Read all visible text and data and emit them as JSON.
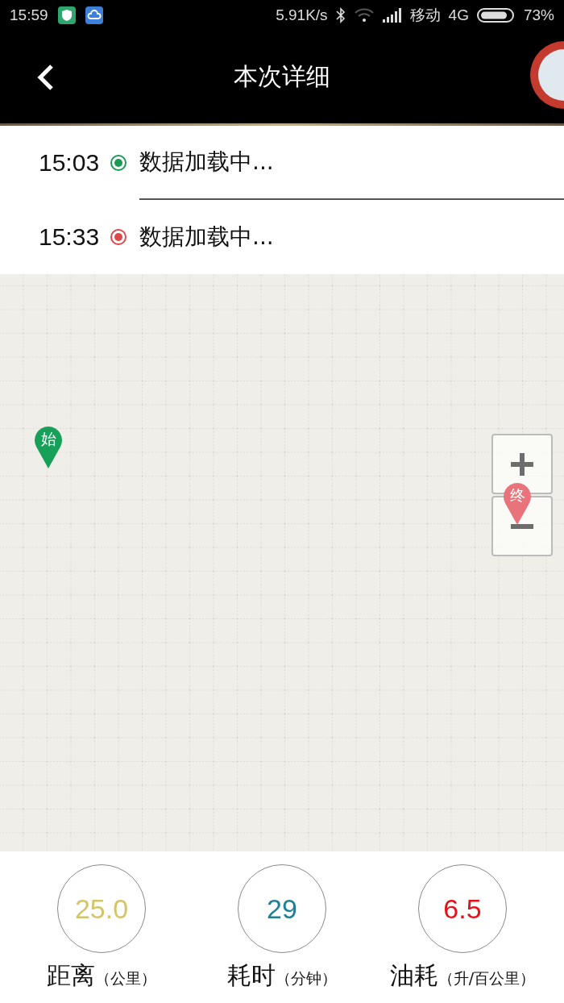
{
  "status_bar": {
    "time": "15:59",
    "speed": "5.91K/s",
    "carrier": "移动",
    "network": "4G",
    "battery": "73%"
  },
  "header": {
    "title": "本次详细"
  },
  "trip_points": [
    {
      "time": "15:03",
      "color": "#1a9a55",
      "text": "数据加载中..."
    },
    {
      "time": "15:33",
      "color": "#e0474c",
      "text": "数据加载中..."
    }
  ],
  "map": {
    "start_marker": "始",
    "end_marker": "终"
  },
  "stats": [
    {
      "value": "25.0",
      "color": "#d4c46a",
      "label": "距离",
      "unit": "（公里）"
    },
    {
      "value": "29",
      "color": "#1f7f96",
      "label": "耗时",
      "unit": "（分钟）"
    },
    {
      "value": "6.5",
      "color": "#e0141a",
      "label": "油耗",
      "unit": "（升/百公里）"
    }
  ]
}
